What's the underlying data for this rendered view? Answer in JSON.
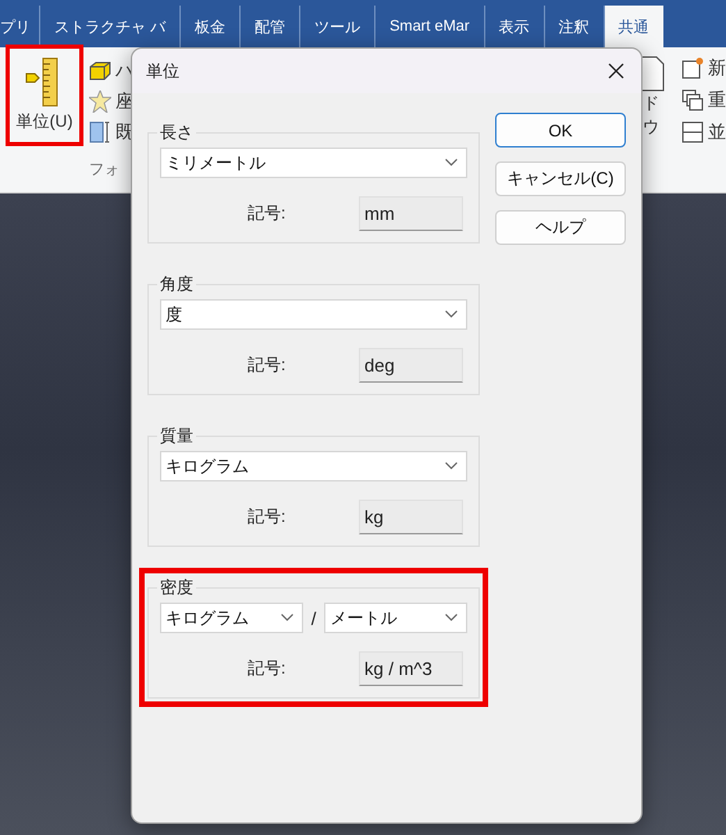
{
  "ribbon": {
    "tabs": [
      {
        "label": "プリ",
        "selected": false
      },
      {
        "label": "ストラクチャ バ",
        "selected": false
      },
      {
        "label": "板金",
        "selected": false
      },
      {
        "label": "配管",
        "selected": false
      },
      {
        "label": "ツール",
        "selected": false
      },
      {
        "label": "Smart eMar",
        "selected": false
      },
      {
        "label": "表示",
        "selected": false
      },
      {
        "label": "注釈",
        "selected": false
      },
      {
        "label": "共通",
        "selected": true
      }
    ],
    "unit_button": {
      "label": "単位(U)",
      "highlighted": true
    },
    "left_items": [
      {
        "kind": "cube",
        "label": "ハ"
      },
      {
        "kind": "sun",
        "label": "座"
      },
      {
        "kind": "bar",
        "label": "既"
      }
    ],
    "group_label": "フォ",
    "right_label": "ドウ",
    "right_items": [
      {
        "kind": "window",
        "label": "新"
      },
      {
        "kind": "stack",
        "label": "重"
      },
      {
        "kind": "split",
        "label": "並"
      }
    ]
  },
  "dialog": {
    "title": "単位",
    "groups": [
      {
        "kind": "single",
        "title": "長さ",
        "units": [
          "ミリメートル"
        ],
        "symbol_label": "記号:",
        "symbol": "mm",
        "highlighted": false
      },
      {
        "kind": "single",
        "title": "角度",
        "units": [
          "度"
        ],
        "symbol_label": "記号:",
        "symbol": "deg",
        "highlighted": false
      },
      {
        "kind": "single",
        "title": "質量",
        "units": [
          "キログラム"
        ],
        "symbol_label": "記号:",
        "symbol": "kg",
        "highlighted": false
      },
      {
        "kind": "ratio",
        "title": "密度",
        "units": [
          "キログラム",
          "メートル"
        ],
        "separator": "/",
        "symbol_label": "記号:",
        "symbol": "kg / m^3",
        "highlighted": true
      }
    ],
    "buttons": [
      {
        "label": "OK",
        "default": true
      },
      {
        "label": "キャンセル(C)",
        "default": false
      },
      {
        "label": "ヘルプ",
        "default": false
      }
    ]
  }
}
